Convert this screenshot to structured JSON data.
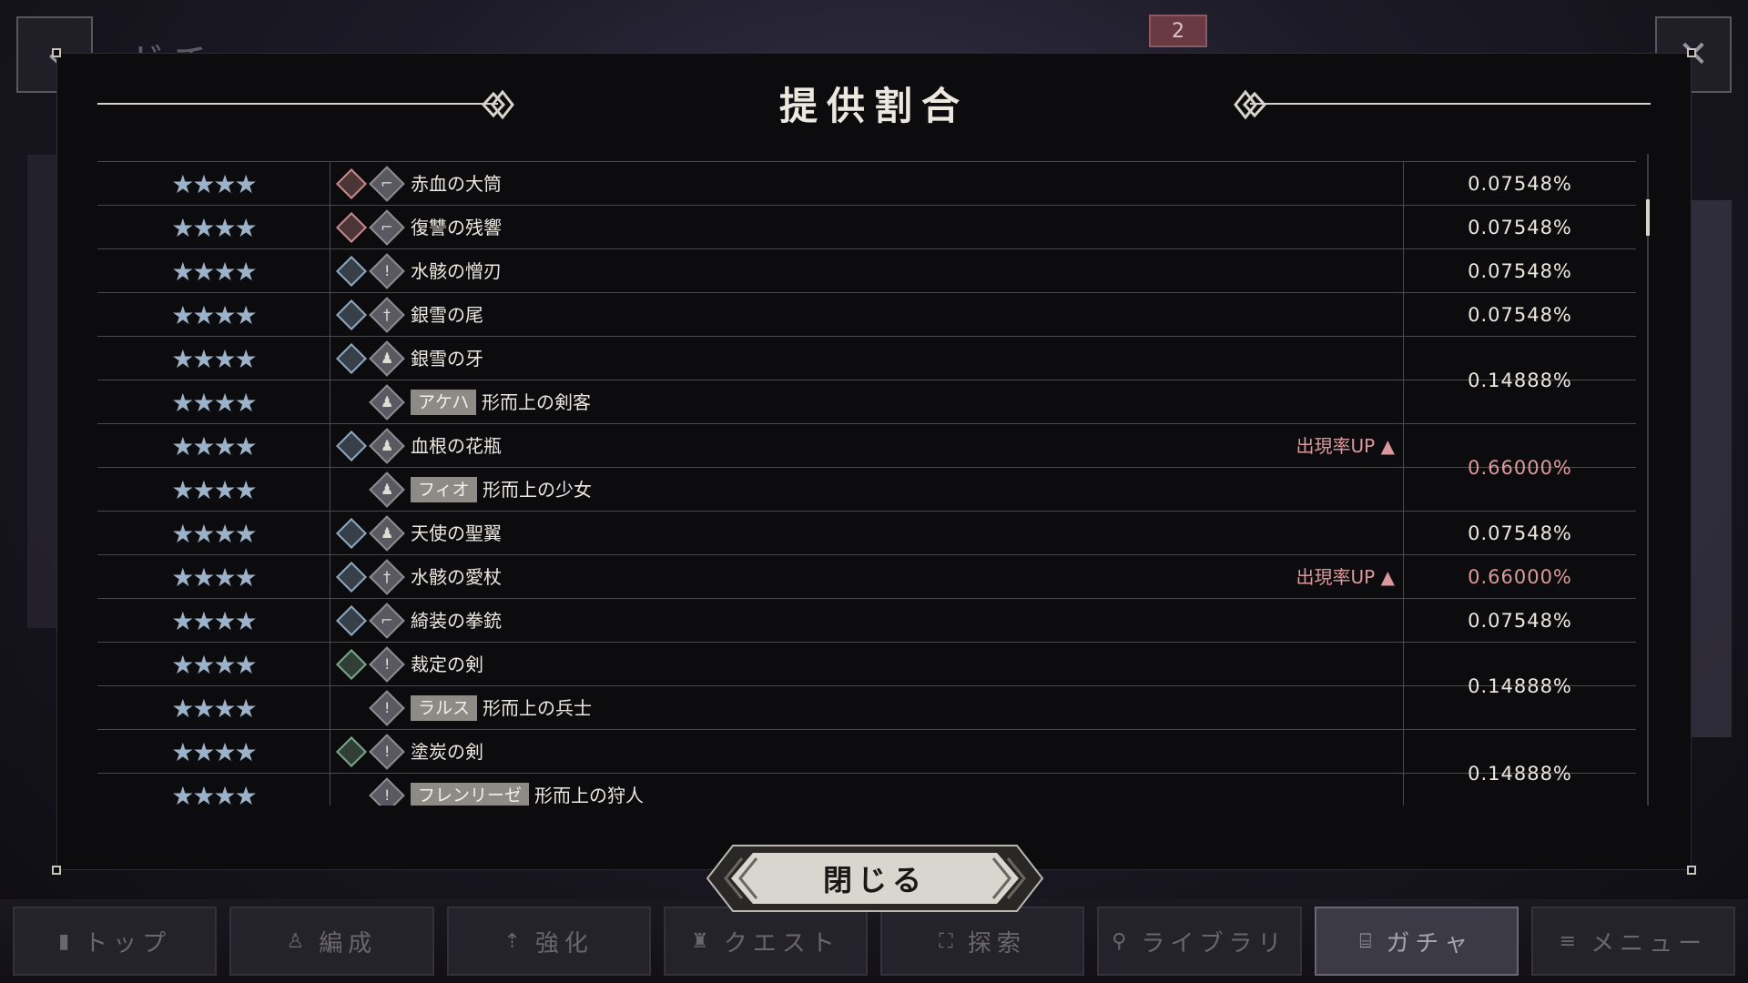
{
  "background": {
    "back_icon": "‹",
    "screen_title": "ガチャ",
    "ticket_count": "2",
    "fullscreen_icon": "✕"
  },
  "nav": [
    {
      "label": "トップ",
      "icon": "▮"
    },
    {
      "label": "編成",
      "icon": "♙"
    },
    {
      "label": "強化",
      "icon": "⇡"
    },
    {
      "label": "クエスト",
      "icon": "♜"
    },
    {
      "label": "探索",
      "icon": "⛶"
    },
    {
      "label": "ライブラリ",
      "icon": "⚲"
    },
    {
      "label": "ガチャ",
      "icon": "⌸"
    },
    {
      "label": "メニュー",
      "icon": "≡"
    }
  ],
  "modal": {
    "title": "提供割合",
    "close_label": "閉じる"
  },
  "colors": {
    "rate_up": "#d99a9e",
    "attr_fire": "#c98a8a",
    "attr_water": "#8ea8c2",
    "attr_wind": "#7aa88a",
    "stars": "#9cb2c8"
  },
  "rows": [
    {
      "stars": "★★★★",
      "attr": "fire",
      "type": "gun",
      "name": "赤血の大筒"
    },
    {
      "stars": "★★★★",
      "attr": "fire",
      "type": "gun",
      "name": "復讐の残響"
    },
    {
      "stars": "★★★★",
      "attr": "water",
      "type": "sword",
      "name": "水骸の憎刃"
    },
    {
      "stars": "★★★★",
      "attr": "water",
      "type": "staff",
      "name": "銀雪の尾"
    },
    {
      "stars": "★★★★",
      "attr": "water",
      "type": "bell",
      "name": "銀雪の牙"
    },
    {
      "stars": "★★★★",
      "attr": "",
      "type": "bell",
      "tag": "アケハ",
      "name": "形而上の剣客"
    },
    {
      "stars": "★★★★",
      "attr": "water",
      "type": "bell",
      "name": "血根の花瓶",
      "rate_up": "出現率UP"
    },
    {
      "stars": "★★★★",
      "attr": "",
      "type": "bell",
      "tag": "フィオ",
      "name": "形而上の少女"
    },
    {
      "stars": "★★★★",
      "attr": "water",
      "type": "bell",
      "name": "天使の聖翼"
    },
    {
      "stars": "★★★★",
      "attr": "water",
      "type": "staff",
      "name": "水骸の愛杖",
      "rate_up": "出現率UP"
    },
    {
      "stars": "★★★★",
      "attr": "water",
      "type": "gun",
      "name": "綺装の拳銃"
    },
    {
      "stars": "★★★★",
      "attr": "wind",
      "type": "sword",
      "name": "裁定の剣"
    },
    {
      "stars": "★★★★",
      "attr": "",
      "type": "sword",
      "tag": "ラルス",
      "name": "形而上の兵士"
    },
    {
      "stars": "★★★★",
      "attr": "wind",
      "type": "sword",
      "name": "塗炭の剣"
    },
    {
      "stars": "★★★★",
      "attr": "",
      "type": "sword",
      "tag": "フレンリーゼ",
      "name": "形而上の狩人"
    }
  ],
  "rates": [
    {
      "value": "0.07548%",
      "start": 0,
      "span": 1
    },
    {
      "value": "0.07548%",
      "start": 1,
      "span": 1
    },
    {
      "value": "0.07548%",
      "start": 2,
      "span": 1
    },
    {
      "value": "0.07548%",
      "start": 3,
      "span": 1
    },
    {
      "value": "0.14888%",
      "start": 4,
      "span": 2
    },
    {
      "value": "0.66000%",
      "start": 6,
      "span": 2,
      "up": true
    },
    {
      "value": "0.07548%",
      "start": 8,
      "span": 1
    },
    {
      "value": "0.66000%",
      "start": 9,
      "span": 1,
      "up": true
    },
    {
      "value": "0.07548%",
      "start": 10,
      "span": 1
    },
    {
      "value": "0.14888%",
      "start": 11,
      "span": 2
    },
    {
      "value": "0.14888%",
      "start": 13,
      "span": 2
    }
  ]
}
